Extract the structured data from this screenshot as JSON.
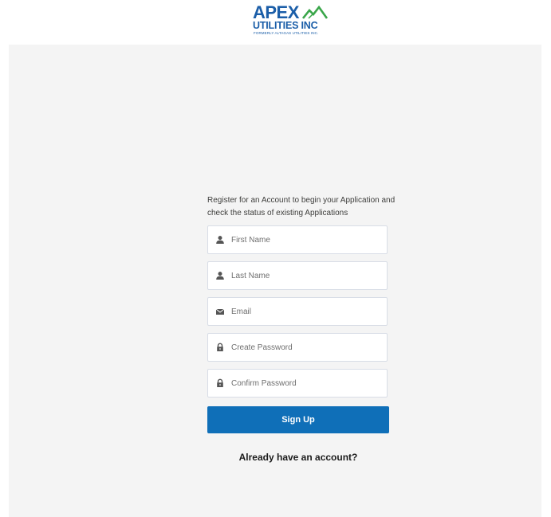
{
  "logo": {
    "brand": "APEX",
    "subtitle": "UTILITIES INC",
    "formerly": "FORMERLY ALTAGAS UTILITIES INC."
  },
  "intro": {
    "text": "Register for an Account to begin your Application and check the status of existing Applications"
  },
  "form": {
    "first_name_placeholder": "First Name",
    "last_name_placeholder": "Last Name",
    "email_placeholder": "Email",
    "create_password_placeholder": "Create Password",
    "confirm_password_placeholder": "Confirm Password",
    "signup_label": "Sign Up",
    "login_link": "Already have an account?"
  },
  "icons": {
    "first_name": "user-icon",
    "last_name": "user-icon",
    "email": "envelope-icon",
    "create_password": "lock-icon",
    "confirm_password": "lock-icon",
    "logo_mark": "mountain-icon"
  },
  "colors": {
    "brand_blue": "#1b5ea8",
    "brand_green": "#3aa64a",
    "button": "#0f6fb8",
    "panel_bg": "#f4f4f4"
  }
}
